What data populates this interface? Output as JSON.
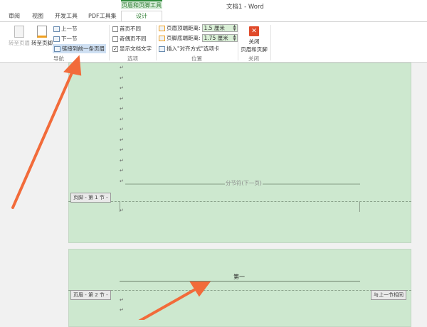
{
  "window": {
    "title": "文档1 - Word"
  },
  "context_tab": {
    "group": "页眉和页脚工具",
    "label": "设计"
  },
  "tabs": [
    "审阅",
    "视图",
    "开发工具",
    "PDF工具集"
  ],
  "ribbon": {
    "nav": {
      "goto_header": "转至页眉",
      "goto_footer": "转至页脚",
      "prev": "上一节",
      "next": "下一节",
      "link_prev": "链接到前一条页眉",
      "label": "导航"
    },
    "options": {
      "first_page": "首页不同",
      "odd_even": "奇偶页不同",
      "show_text": "显示文档文字",
      "show_text_checked": true,
      "label": "选项"
    },
    "position": {
      "header_top_label": "页眉顶端距离:",
      "header_top": "1.5 厘米",
      "footer_bottom_label": "页脚底端距离:",
      "footer_bottom": "1.75 厘米",
      "insert_align": "插入\"对齐方式\"选项卡",
      "label": "位置"
    },
    "close": {
      "button": "关闭",
      "button2": "页眉和页脚",
      "label": "关闭"
    }
  },
  "document": {
    "para_mark": "↵",
    "section_break": "分节符(下一页)",
    "footer_tag": "页脚 - 第 1 节 -",
    "header_tag": "页眉 - 第 2 节 -",
    "same_as_prev": "与上一节相同",
    "header_text": "第一"
  },
  "colors": {
    "accent": "#2e7d32",
    "page": "#cde8cf",
    "arrow": "#f26b3a",
    "close": "#e04b2b"
  }
}
